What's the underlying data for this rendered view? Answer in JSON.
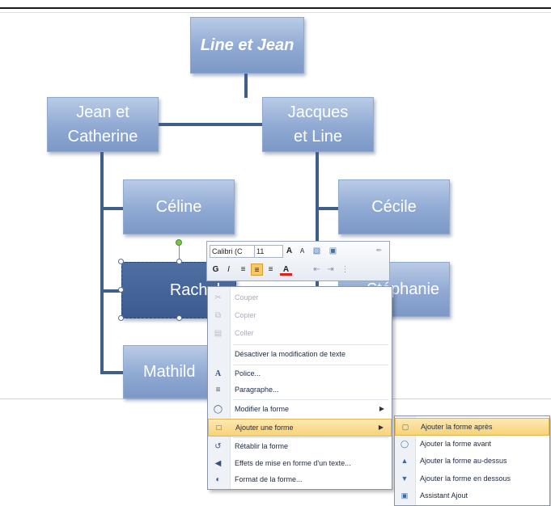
{
  "diagram": {
    "root": "Line et Jean",
    "left_parent_line1": "Jean et",
    "left_parent_line2": "Catherine",
    "right_parent_line1": "Jacques",
    "right_parent_line2": "et Line",
    "celine": "Céline",
    "rachel": "Rachel",
    "mathilde": "Mathild",
    "cecile": "Cécile",
    "stephanie": "Stéphanie"
  },
  "mini_toolbar": {
    "font_name": "Calibri (C",
    "font_size": "11",
    "grow_font": "A",
    "shrink_font": "A",
    "bold": "G",
    "italic": "I",
    "font_color": "A"
  },
  "context_menu": {
    "items": [
      {
        "label": "Couper",
        "icon": "scissors-icon",
        "enabled": false
      },
      {
        "label": "Copier",
        "icon": "copy-icon",
        "enabled": false
      },
      {
        "label": "Coller",
        "icon": "paste-icon",
        "enabled": false
      },
      {
        "label": "Désactiver la modification de texte",
        "icon": "",
        "enabled": true
      },
      {
        "label": "Police...",
        "icon": "font-icon",
        "enabled": true
      },
      {
        "label": "Paragraphe...",
        "icon": "paragraph-icon",
        "enabled": true
      },
      {
        "label": "Modifier la forme",
        "icon": "shape-icon",
        "enabled": true,
        "submenu": true
      },
      {
        "label": "Ajouter une forme",
        "icon": "add-shape-icon",
        "enabled": true,
        "submenu": true,
        "highlighted": true
      },
      {
        "label": "Rétablir la forme",
        "icon": "reset-shape-icon",
        "enabled": true
      },
      {
        "label": "Effets de mise en forme d'un texte...",
        "icon": "text-effects-icon",
        "enabled": true
      },
      {
        "label": "Format de la forme...",
        "icon": "format-shape-icon",
        "enabled": true
      }
    ]
  },
  "submenu": {
    "items": [
      {
        "label": "Ajouter la forme après",
        "icon": "add-after-icon",
        "highlighted": true
      },
      {
        "label": "Ajouter la forme avant",
        "icon": "add-before-icon"
      },
      {
        "label": "Ajouter la forme au-dessus",
        "icon": "add-above-icon"
      },
      {
        "label": "Ajouter la forme en dessous",
        "icon": "add-below-icon"
      },
      {
        "label": "Assistant Ajout",
        "icon": "add-assistant-icon"
      }
    ]
  },
  "colors": {
    "shape_fill": "#8fa9d3",
    "selected_shape_fill": "#3c5b90",
    "connector": "#3e5f8d",
    "menu_highlight": "#f8d278"
  }
}
